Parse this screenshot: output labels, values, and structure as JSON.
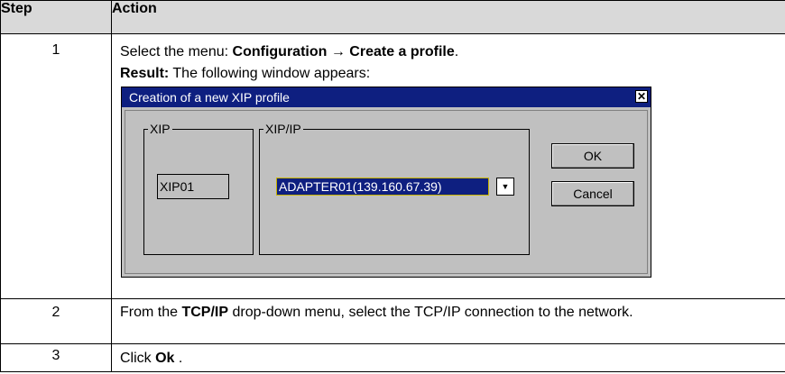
{
  "table": {
    "header": {
      "step": "Step",
      "action": "Action"
    },
    "rows": [
      {
        "step": "1",
        "line1_prefix": "Select the menu: ",
        "line1_bold1": "Configuration",
        "line1_arrow": " → ",
        "line1_bold2": "Create a profile",
        "line1_suffix": ".",
        "result_label": "Result:",
        "result_text": " The following window appears:"
      },
      {
        "step": "2",
        "text_prefix": "From the ",
        "text_bold": "TCP/IP",
        "text_suffix": " drop-down menu, select the TCP/IP connection to the network."
      },
      {
        "step": "3",
        "text_prefix": "Click ",
        "text_bold": "Ok",
        "text_suffix": " ."
      }
    ]
  },
  "dialog": {
    "title": "Creation of a new XIP profile",
    "close_glyph": "✕",
    "group_xip": {
      "legend": "XIP",
      "value": "XIP01"
    },
    "group_xipip": {
      "legend": "XIP/IP",
      "selected": "ADAPTER01(139.160.67.39)",
      "dropdown_glyph": "▼"
    },
    "ok_label": "OK",
    "cancel_label": "Cancel"
  },
  "colors": {
    "header_bg": "#d9d9d9",
    "dialog_bg": "#c0c0c0",
    "titlebar": "#0e1f80",
    "highlight_border": "#c8b400"
  }
}
